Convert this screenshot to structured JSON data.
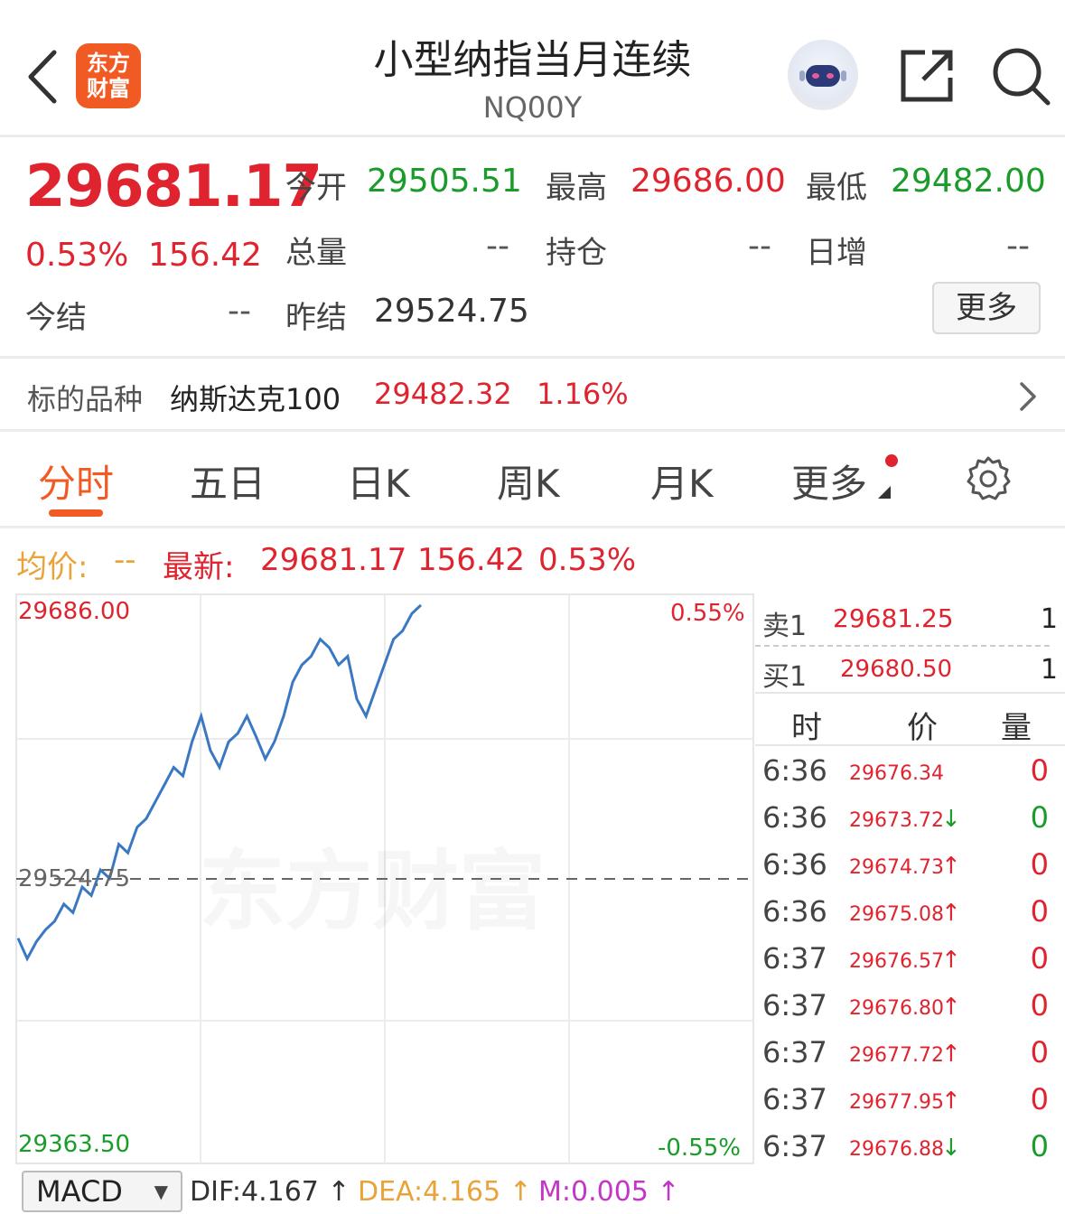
{
  "header": {
    "title": "小型纳指当月连续",
    "code": "NQ00Y",
    "logo_line1": "东方",
    "logo_line2": "财富"
  },
  "quote": {
    "last": "29681.17",
    "pct": "0.53%",
    "change": "156.42",
    "open_label": "今开",
    "open": "29505.51",
    "high_label": "最高",
    "high": "29686.00",
    "low_label": "最低",
    "low": "29482.00",
    "volume_label": "总量",
    "volume": "--",
    "oi_label": "持仓",
    "oi": "--",
    "daily_inc_label": "日增",
    "daily_inc": "--",
    "settle_label": "今结",
    "settle": "--",
    "prev_settle_label": "昨结",
    "prev_settle": "29524.75",
    "more_button": "更多"
  },
  "underlying": {
    "label": "标的品种",
    "name": "纳斯达克100",
    "price": "29482.32",
    "pct": "1.16%"
  },
  "tabs": [
    "分时",
    "五日",
    "日K",
    "周K",
    "月K",
    "更多"
  ],
  "active_tab": "分时",
  "info_line": {
    "avg_label": "均价:",
    "avg_value": "--",
    "latest_label": "最新:",
    "latest_value": "29681.17",
    "change": "156.42",
    "pct": "0.53%"
  },
  "chart_data": {
    "type": "line",
    "series": [
      {
        "values": [
          29490,
          29478,
          29488,
          29495,
          29500,
          29510,
          29505,
          29520,
          29515,
          29530,
          29525,
          29545,
          29540,
          29555,
          29560,
          29570,
          29580,
          29590,
          29585,
          29605,
          29620,
          29600,
          29590,
          29605,
          29610,
          29620,
          29608,
          29595,
          29605,
          29620,
          29640,
          29650,
          29655,
          29665,
          29660,
          29650,
          29655,
          29630,
          29620,
          29635,
          29650,
          29665,
          29670,
          29680,
          29685
        ]
      }
    ],
    "ylim": [
      29363.5,
      29686.0
    ],
    "y_left_ticks": [
      "29686.00",
      "29524.75",
      "29363.50"
    ],
    "y_right_ticks": [
      "0.55%",
      "-0.55%"
    ],
    "reference_line": 29524.75,
    "watermark": "东方财富",
    "line_color": "#3a78c3"
  },
  "order_book": {
    "sell_label": "卖1",
    "sell_price": "29681.25",
    "sell_qty": "1",
    "buy_label": "买1",
    "buy_price": "29680.50",
    "buy_qty": "1"
  },
  "ticks_header": {
    "time": "时",
    "price": "价",
    "volume": "量"
  },
  "ticks": [
    {
      "time": "6:36",
      "price": "29676.34",
      "arrow": "",
      "vol": "0",
      "vol_color": "red"
    },
    {
      "time": "6:36",
      "price": "29673.72",
      "arrow": "↓",
      "vol": "0",
      "vol_color": "green"
    },
    {
      "time": "6:36",
      "price": "29674.73",
      "arrow": "↑",
      "vol": "0",
      "vol_color": "red"
    },
    {
      "time": "6:36",
      "price": "29675.08",
      "arrow": "↑",
      "vol": "0",
      "vol_color": "red"
    },
    {
      "time": "6:37",
      "price": "29676.57",
      "arrow": "↑",
      "vol": "0",
      "vol_color": "red"
    },
    {
      "time": "6:37",
      "price": "29676.80",
      "arrow": "↑",
      "vol": "0",
      "vol_color": "red"
    },
    {
      "time": "6:37",
      "price": "29677.72",
      "arrow": "↑",
      "vol": "0",
      "vol_color": "red"
    },
    {
      "time": "6:37",
      "price": "29677.95",
      "arrow": "↑",
      "vol": "0",
      "vol_color": "red"
    },
    {
      "time": "6:37",
      "price": "29676.88",
      "arrow": "↓",
      "vol": "0",
      "vol_color": "green"
    }
  ],
  "macd": {
    "selector": "MACD",
    "dif": "DIF:4.167 ↑",
    "dea": "DEA:4.165 ↑",
    "m": "M:0.005 ↑"
  }
}
